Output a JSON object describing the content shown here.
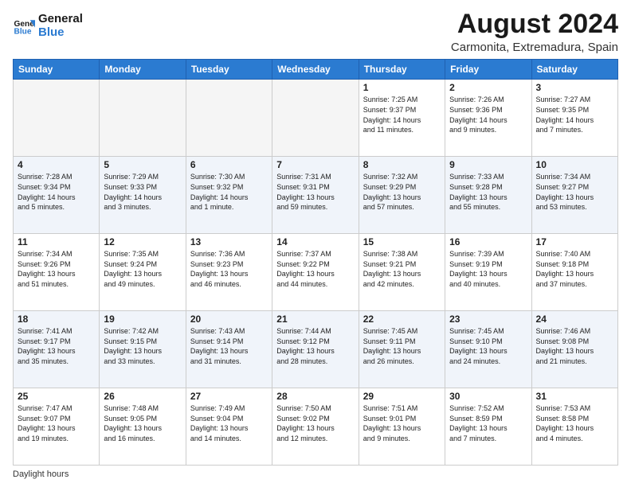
{
  "logo": {
    "line1": "General",
    "line2": "Blue"
  },
  "title": "August 2024",
  "location": "Carmonita, Extremadura, Spain",
  "footer": "Daylight hours",
  "headers": [
    "Sunday",
    "Monday",
    "Tuesday",
    "Wednesday",
    "Thursday",
    "Friday",
    "Saturday"
  ],
  "weeks": [
    [
      {
        "day": "",
        "detail": ""
      },
      {
        "day": "",
        "detail": ""
      },
      {
        "day": "",
        "detail": ""
      },
      {
        "day": "",
        "detail": ""
      },
      {
        "day": "1",
        "detail": "Sunrise: 7:25 AM\nSunset: 9:37 PM\nDaylight: 14 hours\nand 11 minutes."
      },
      {
        "day": "2",
        "detail": "Sunrise: 7:26 AM\nSunset: 9:36 PM\nDaylight: 14 hours\nand 9 minutes."
      },
      {
        "day": "3",
        "detail": "Sunrise: 7:27 AM\nSunset: 9:35 PM\nDaylight: 14 hours\nand 7 minutes."
      }
    ],
    [
      {
        "day": "4",
        "detail": "Sunrise: 7:28 AM\nSunset: 9:34 PM\nDaylight: 14 hours\nand 5 minutes."
      },
      {
        "day": "5",
        "detail": "Sunrise: 7:29 AM\nSunset: 9:33 PM\nDaylight: 14 hours\nand 3 minutes."
      },
      {
        "day": "6",
        "detail": "Sunrise: 7:30 AM\nSunset: 9:32 PM\nDaylight: 14 hours\nand 1 minute."
      },
      {
        "day": "7",
        "detail": "Sunrise: 7:31 AM\nSunset: 9:31 PM\nDaylight: 13 hours\nand 59 minutes."
      },
      {
        "day": "8",
        "detail": "Sunrise: 7:32 AM\nSunset: 9:29 PM\nDaylight: 13 hours\nand 57 minutes."
      },
      {
        "day": "9",
        "detail": "Sunrise: 7:33 AM\nSunset: 9:28 PM\nDaylight: 13 hours\nand 55 minutes."
      },
      {
        "day": "10",
        "detail": "Sunrise: 7:34 AM\nSunset: 9:27 PM\nDaylight: 13 hours\nand 53 minutes."
      }
    ],
    [
      {
        "day": "11",
        "detail": "Sunrise: 7:34 AM\nSunset: 9:26 PM\nDaylight: 13 hours\nand 51 minutes."
      },
      {
        "day": "12",
        "detail": "Sunrise: 7:35 AM\nSunset: 9:24 PM\nDaylight: 13 hours\nand 49 minutes."
      },
      {
        "day": "13",
        "detail": "Sunrise: 7:36 AM\nSunset: 9:23 PM\nDaylight: 13 hours\nand 46 minutes."
      },
      {
        "day": "14",
        "detail": "Sunrise: 7:37 AM\nSunset: 9:22 PM\nDaylight: 13 hours\nand 44 minutes."
      },
      {
        "day": "15",
        "detail": "Sunrise: 7:38 AM\nSunset: 9:21 PM\nDaylight: 13 hours\nand 42 minutes."
      },
      {
        "day": "16",
        "detail": "Sunrise: 7:39 AM\nSunset: 9:19 PM\nDaylight: 13 hours\nand 40 minutes."
      },
      {
        "day": "17",
        "detail": "Sunrise: 7:40 AM\nSunset: 9:18 PM\nDaylight: 13 hours\nand 37 minutes."
      }
    ],
    [
      {
        "day": "18",
        "detail": "Sunrise: 7:41 AM\nSunset: 9:17 PM\nDaylight: 13 hours\nand 35 minutes."
      },
      {
        "day": "19",
        "detail": "Sunrise: 7:42 AM\nSunset: 9:15 PM\nDaylight: 13 hours\nand 33 minutes."
      },
      {
        "day": "20",
        "detail": "Sunrise: 7:43 AM\nSunset: 9:14 PM\nDaylight: 13 hours\nand 31 minutes."
      },
      {
        "day": "21",
        "detail": "Sunrise: 7:44 AM\nSunset: 9:12 PM\nDaylight: 13 hours\nand 28 minutes."
      },
      {
        "day": "22",
        "detail": "Sunrise: 7:45 AM\nSunset: 9:11 PM\nDaylight: 13 hours\nand 26 minutes."
      },
      {
        "day": "23",
        "detail": "Sunrise: 7:45 AM\nSunset: 9:10 PM\nDaylight: 13 hours\nand 24 minutes."
      },
      {
        "day": "24",
        "detail": "Sunrise: 7:46 AM\nSunset: 9:08 PM\nDaylight: 13 hours\nand 21 minutes."
      }
    ],
    [
      {
        "day": "25",
        "detail": "Sunrise: 7:47 AM\nSunset: 9:07 PM\nDaylight: 13 hours\nand 19 minutes."
      },
      {
        "day": "26",
        "detail": "Sunrise: 7:48 AM\nSunset: 9:05 PM\nDaylight: 13 hours\nand 16 minutes."
      },
      {
        "day": "27",
        "detail": "Sunrise: 7:49 AM\nSunset: 9:04 PM\nDaylight: 13 hours\nand 14 minutes."
      },
      {
        "day": "28",
        "detail": "Sunrise: 7:50 AM\nSunset: 9:02 PM\nDaylight: 13 hours\nand 12 minutes."
      },
      {
        "day": "29",
        "detail": "Sunrise: 7:51 AM\nSunset: 9:01 PM\nDaylight: 13 hours\nand 9 minutes."
      },
      {
        "day": "30",
        "detail": "Sunrise: 7:52 AM\nSunset: 8:59 PM\nDaylight: 13 hours\nand 7 minutes."
      },
      {
        "day": "31",
        "detail": "Sunrise: 7:53 AM\nSunset: 8:58 PM\nDaylight: 13 hours\nand 4 minutes."
      }
    ]
  ]
}
